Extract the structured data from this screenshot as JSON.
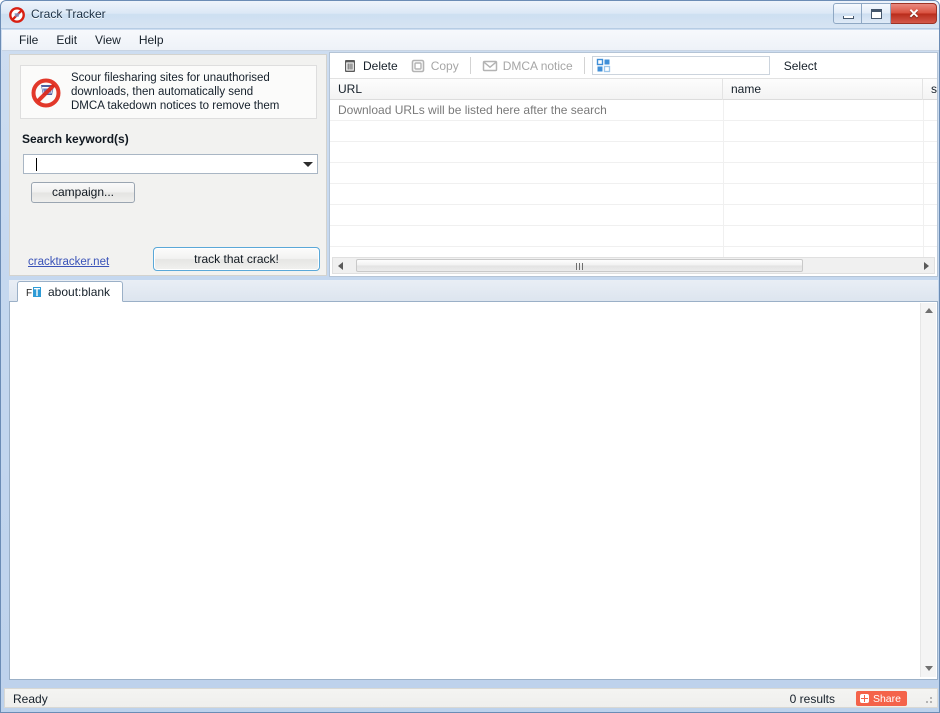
{
  "window": {
    "title": "Crack Tracker",
    "app_icon": "prohibition-icon",
    "buttons": {
      "minimize": "minimize-button",
      "maximize": "maximize-button",
      "close_glyph": "✕"
    }
  },
  "menubar": {
    "items": [
      {
        "label": "File"
      },
      {
        "label": "Edit"
      },
      {
        "label": "View"
      },
      {
        "label": "Help"
      }
    ]
  },
  "left_panel": {
    "info": {
      "icon": "prohibition-icon",
      "text": "Scour filesharing sites for unauthorised\ndownloads, then automatically send\nDMCA takedown notices to remove them"
    },
    "search": {
      "label": "Search keyword(s)",
      "value": "",
      "placeholder": ""
    },
    "campaign_button": "campaign...",
    "track_button": "track that crack!",
    "site_link": "cracktracker.net"
  },
  "results_panel": {
    "toolbar": {
      "delete_label": "Delete",
      "delete_icon": "trash-icon",
      "copy_label": "Copy",
      "copy_icon": "copy-icon",
      "dmca_label": "DMCA notice",
      "dmca_icon": "envelope-icon",
      "filter_icon": "grid-select-icon",
      "filter_value": "",
      "select_label": "Select"
    },
    "columns": [
      {
        "key": "url",
        "label": "URL"
      },
      {
        "key": "name",
        "label": "name"
      },
      {
        "key": "size",
        "label": "siz"
      }
    ],
    "empty_message": "Download URLs will be listed here after the search",
    "rows": []
  },
  "browser": {
    "tab": {
      "icon": "page-icon",
      "label": "about:blank"
    },
    "content": ""
  },
  "statusbar": {
    "status": "Ready",
    "results": "0 results",
    "share_label": "Share",
    "share_icon": "plus-icon",
    "share_color": "#f4634a"
  }
}
